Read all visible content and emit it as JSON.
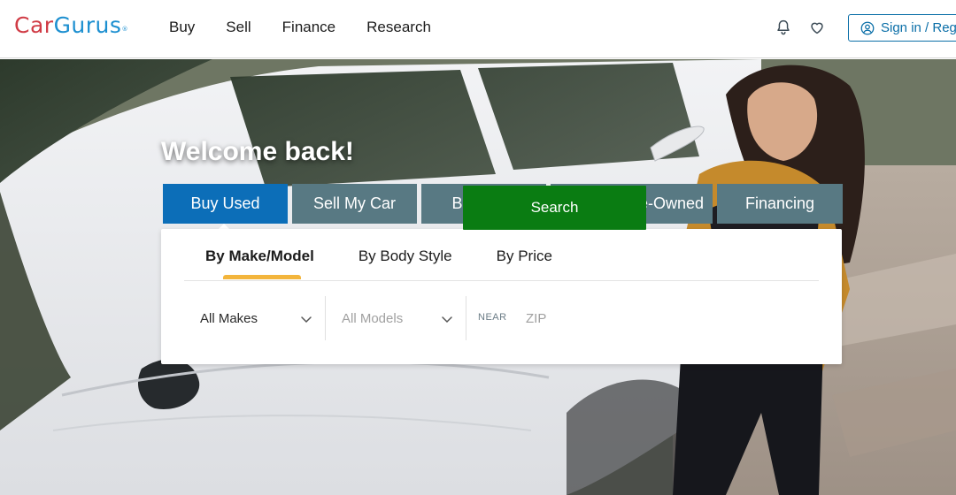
{
  "header": {
    "logo_part1": "Car",
    "logo_part2": "Gurus",
    "logo_mark": "®",
    "nav": [
      "Buy",
      "Sell",
      "Finance",
      "Research"
    ],
    "notifications_icon": "bell-icon",
    "saved_icon": "heart-icon",
    "signin_icon": "user-circle-icon",
    "signin_label": "Sign in / Register"
  },
  "hero": {
    "welcome": "Welcome back!",
    "tabs": [
      "Buy Used",
      "Sell My Car",
      "Buy New",
      "Certified Pre-Owned",
      "Financing"
    ],
    "active_tab": "Buy Used",
    "subtabs": [
      "By Make/Model",
      "By Body Style",
      "By Price"
    ],
    "active_subtab": "By Make/Model",
    "make_value": "All Makes",
    "model_value": "All Models",
    "near_label": "NEAR",
    "zip_placeholder": "ZIP",
    "search_label": "Search"
  },
  "colors": {
    "brand_red": "#d03b45",
    "brand_blue": "#1c8fd0",
    "tab_active": "#0c6eb8",
    "tab_inactive": "#587983",
    "search_green": "#0a7c12",
    "accent_underline": "#f3b53c"
  }
}
